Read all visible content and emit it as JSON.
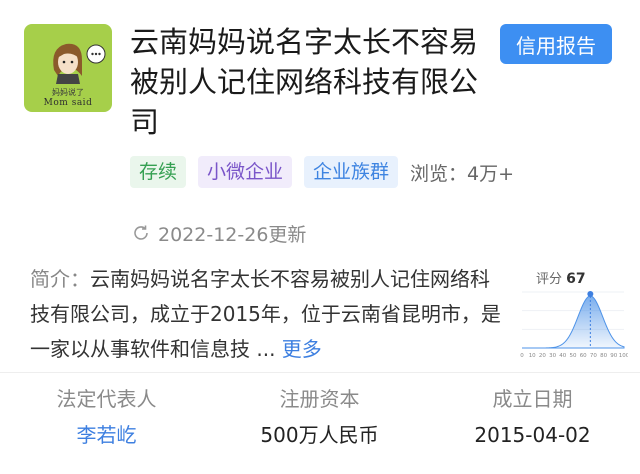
{
  "logo": {
    "caption_cn": "妈妈说了",
    "caption_en": "Mom said"
  },
  "company": {
    "name": "云南妈妈说名字太长不容易被别人记住网络科技有限公司"
  },
  "report_button": "信用报告",
  "tags": [
    "存续",
    "小微企业",
    "企业族群"
  ],
  "views": "浏览：4万+",
  "updated": "2022-12-26更新",
  "intro": {
    "label": "简介：",
    "text": "云南妈妈说名字太长不容易被别人记住网络科技有限公司，成立于2015年，位于云南省昆明市，是一家以从事软件和信息技",
    "ellipsis": "...",
    "more": "更多"
  },
  "score": {
    "label": "评分",
    "value": "67"
  },
  "chart_data": {
    "type": "area",
    "x_ticks": [
      "0",
      "10",
      "20",
      "30",
      "40",
      "50",
      "60",
      "70",
      "80",
      "90",
      "100"
    ],
    "marker_x": 67,
    "xlim": [
      0,
      100
    ]
  },
  "info": [
    {
      "label": "法定代表人",
      "value": "李若屹"
    },
    {
      "label": "注册资本",
      "value": "500万人民币"
    },
    {
      "label": "成立日期",
      "value": "2015-04-02"
    }
  ]
}
